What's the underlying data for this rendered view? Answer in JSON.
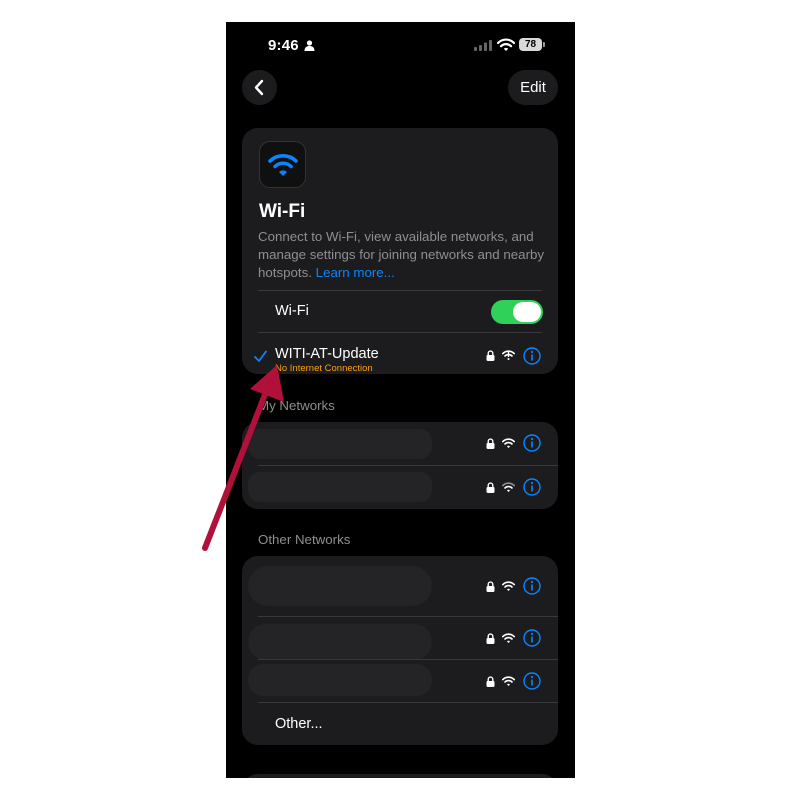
{
  "status_bar": {
    "time": "9:46",
    "battery": "78",
    "icons": [
      "person-icon",
      "cellular-signal-icon",
      "wifi-icon",
      "battery-icon"
    ]
  },
  "nav": {
    "back_icon": "chevron-left-icon",
    "edit_label": "Edit"
  },
  "wifi_card": {
    "app_icon": "wifi-icon",
    "title": "Wi-Fi",
    "description": "Connect to Wi-Fi, view available networks, and manage settings for joining networks and nearby hotspots.",
    "learn_more": "Learn more...",
    "toggle_label": "Wi-Fi",
    "toggle_on": true,
    "connected_network": {
      "name": "WITI-AT-Update",
      "status": "No Internet Connection",
      "icons": [
        "checkmark-icon",
        "lock-icon",
        "wifi-no-internet-icon",
        "info-icon"
      ]
    }
  },
  "my_networks": {
    "header": "My Networks",
    "rows": [
      {
        "icons": [
          "lock-icon",
          "wifi-icon",
          "info-icon"
        ]
      },
      {
        "icons": [
          "lock-icon",
          "wifi-icon",
          "info-icon"
        ]
      }
    ]
  },
  "other_networks": {
    "header": "Other Networks",
    "rows": [
      {
        "icons": [
          "lock-icon",
          "wifi-icon",
          "info-icon"
        ]
      },
      {
        "icons": [
          "lock-icon",
          "wifi-icon",
          "info-icon"
        ]
      },
      {
        "icons": [
          "lock-icon",
          "wifi-icon",
          "info-icon"
        ]
      }
    ],
    "other_label": "Other..."
  },
  "colors": {
    "accent": "#0a84ff",
    "toggle_on": "#30d158",
    "warning": "#ff9f0a",
    "annotation_arrow": "#b0103a",
    "card_bg": "#1c1c1e",
    "screen_bg": "#000000"
  }
}
